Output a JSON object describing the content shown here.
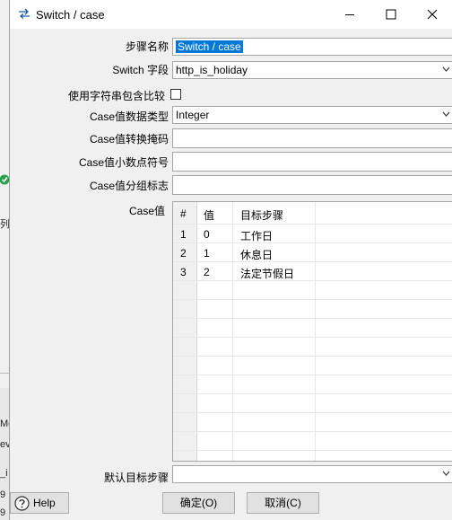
{
  "window": {
    "title": "Switch / case",
    "minimize_icon": "minimize-icon",
    "maximize_icon": "maximize-icon",
    "close_icon": "close-icon"
  },
  "background_app": {
    "label_1": "列",
    "label_2": "Me",
    "label_3": "ev",
    "label_4": "_i",
    "label_5": "9",
    "label_6": "9",
    "check_icon": "green-check-icon"
  },
  "form": {
    "step_name_label": "步骤名称",
    "step_name_value": "Switch / case",
    "switch_field_label": "Switch 字段",
    "switch_field_value": "http_is_holiday",
    "string_contains_label": "使用字符串包含比较",
    "string_contains_checked": false,
    "case_type_label": "Case值数据类型",
    "case_type_value": "Integer",
    "case_mask_label": "Case值转换掩码",
    "case_mask_value": "",
    "case_decimal_label": "Case值小数点符号",
    "case_decimal_value": "",
    "case_group_label": "Case值分组标志",
    "case_group_value": "",
    "case_values_label": "Case值",
    "default_target_label": "默认目标步骤",
    "default_target_value": ""
  },
  "table": {
    "headers": [
      "#",
      "值",
      "目标步骤"
    ],
    "rows": [
      {
        "idx": "1",
        "value": "0",
        "target": "工作日"
      },
      {
        "idx": "2",
        "value": "1",
        "target": "休息日"
      },
      {
        "idx": "3",
        "value": "2",
        "target": "法定节假日"
      }
    ]
  },
  "buttons": {
    "help": "Help",
    "ok": "确定(O)",
    "cancel": "取消(C)"
  }
}
